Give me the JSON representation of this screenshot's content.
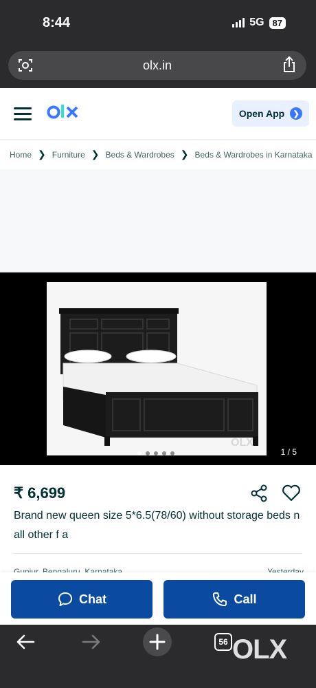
{
  "status": {
    "time": "8:44",
    "network": "5G",
    "battery": "87"
  },
  "browser": {
    "url": "olx.in",
    "tab_count": "56"
  },
  "header": {
    "logo": "olx",
    "open_app_label": "Open App"
  },
  "breadcrumb": [
    "Home",
    "Furniture",
    "Beds & Wardrobes",
    "Beds & Wardrobes in Karnataka",
    "..."
  ],
  "gallery": {
    "counter": "1 / 5",
    "current_index": 1,
    "total": 5,
    "watermark": "OLX"
  },
  "listing": {
    "price": "₹ 6,699",
    "title": "Brand new queen size 5*6.5(78/60) without storage beds n all other f a",
    "location": "Gunjur, Bengaluru, Karnataka",
    "posted": "Yesterday"
  },
  "actions": {
    "chat_label": "Chat",
    "call_label": "Call"
  },
  "nav_watermark": "OLX",
  "colors": {
    "brand_blue": "#0a4aa0",
    "accent_blue": "#3a77ff",
    "logo_teal": "#23e5db",
    "text": "#002f34"
  }
}
